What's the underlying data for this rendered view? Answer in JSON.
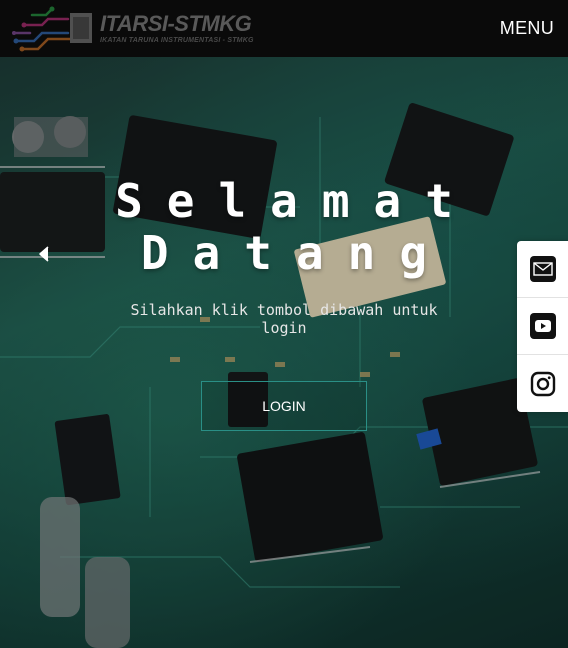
{
  "header": {
    "brand_name": "ITARSI-STMKG",
    "brand_tagline": "IKATAN TARUNA INSTRUMENTASI - STMKG",
    "menu_label": "MENU"
  },
  "hero": {
    "title_line1": "Selamat",
    "title_line2": "Datang",
    "subtitle": "Silahkan klik tombol dibawah untuk login",
    "login_label": "LOGIN"
  },
  "icons": {
    "prev": "chevron-left-icon",
    "email": "email-icon",
    "youtube": "youtube-icon",
    "instagram": "instagram-icon"
  },
  "colors": {
    "header_bg": "#0a0a0a",
    "button_border": "#2a8f86",
    "board_green": "#1f5a4e"
  }
}
